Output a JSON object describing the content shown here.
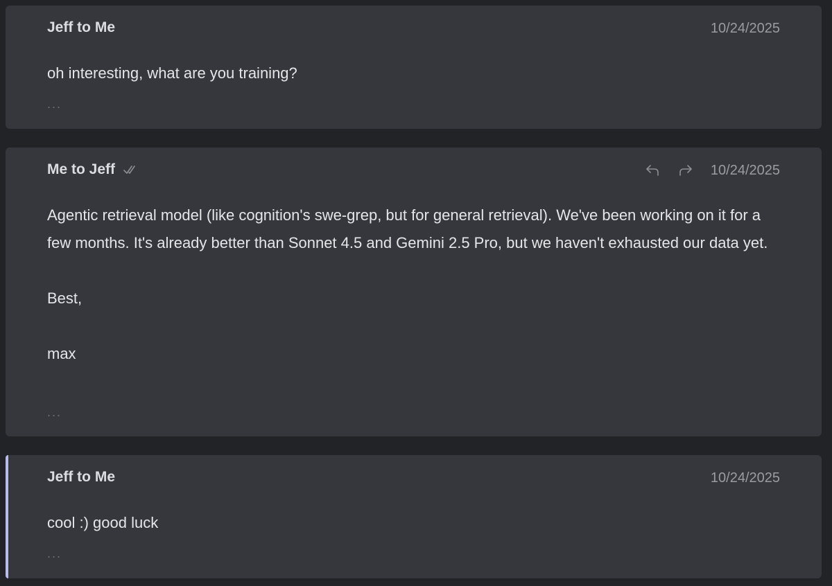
{
  "thread": {
    "messages": [
      {
        "sender": "Jeff to Me",
        "date": "10/24/2025",
        "body": [
          "oh interesting, what are you training?"
        ],
        "more": "..."
      },
      {
        "sender": "Me to Jeff",
        "date": "10/24/2025",
        "read_icon": "double-check-icon",
        "actions": {
          "reply_icon": "reply-icon",
          "forward_icon": "forward-icon"
        },
        "body": [
          "Agentic retrieval model (like cognition's swe-grep, but for general retrieval). We've been working on it for a few months. It's already better than Sonnet 4.5 and Gemini 2.5 Pro, but we haven't exhausted our data yet.",
          "Best,",
          "max"
        ],
        "more": "..."
      },
      {
        "sender": "Jeff to Me",
        "date": "10/24/2025",
        "body": [
          "cool :) good luck"
        ],
        "more": "..."
      }
    ]
  },
  "colors": {
    "background": "#222327",
    "card": "#36373c",
    "text": "#e6e6e9",
    "muted": "#9a9ca3",
    "selected_accent": "#b9bce8"
  }
}
